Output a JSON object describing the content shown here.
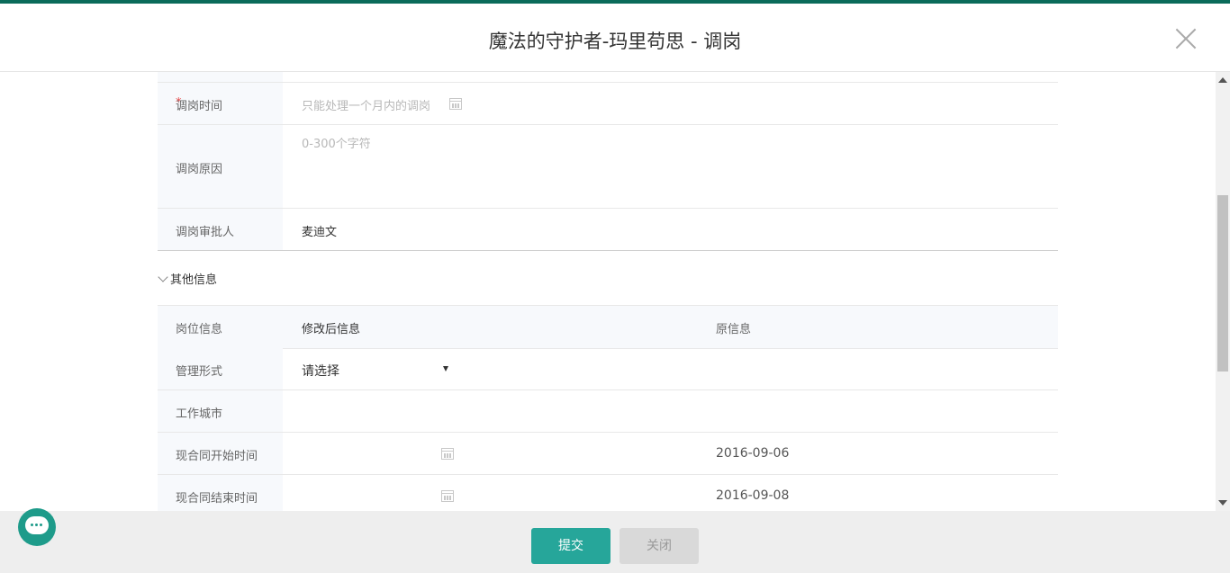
{
  "dialog": {
    "title": "魔法的守护者-玛里苟思 - 调岗"
  },
  "form": {
    "transfer_time": {
      "label": "调岗时间",
      "required_mark": "*",
      "placeholder": "只能处理一个月内的调岗"
    },
    "reason": {
      "label": "调岗原因",
      "placeholder": "0-300个字符"
    },
    "approver": {
      "label": "调岗审批人",
      "value": "麦迪文"
    }
  },
  "other_info": {
    "section_label": "其他信息",
    "columns": [
      "岗位信息",
      "修改后信息",
      "原信息"
    ],
    "rows": [
      {
        "label": "管理形式",
        "new_value": "请选择",
        "original": ""
      },
      {
        "label": "工作城市",
        "new_value": "",
        "original": ""
      },
      {
        "label": "现合同开始时间",
        "new_value": "",
        "original": "2016-09-06"
      },
      {
        "label": "现合同结束时间",
        "new_value": "",
        "original": "2016-09-08"
      }
    ]
  },
  "footer": {
    "submit_label": "提交",
    "close_label": "关闭"
  },
  "icons": {
    "close": "close-icon",
    "calendar": "calendar-icon",
    "chevron": "chevron-down-icon",
    "chat": "chat-support-icon"
  },
  "colors": {
    "accent": "#26a69a",
    "top_bar": "#0b6b5a",
    "required": "#e64343"
  }
}
